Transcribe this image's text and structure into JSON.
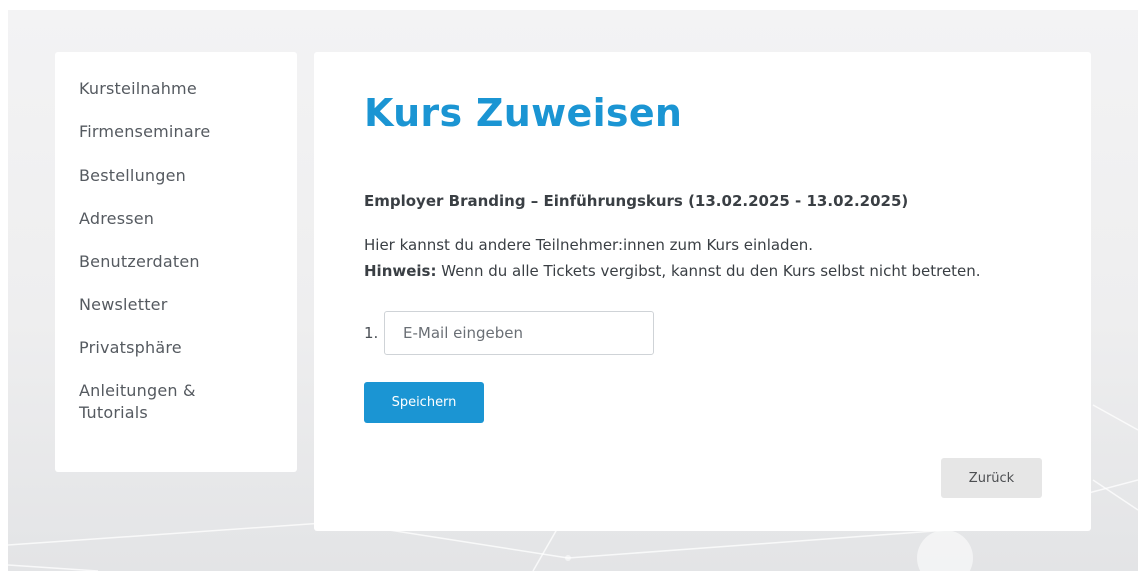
{
  "sidebar": {
    "items": [
      {
        "label": "Kursteilnahme"
      },
      {
        "label": "Firmenseminare"
      },
      {
        "label": "Bestellungen"
      },
      {
        "label": "Adressen"
      },
      {
        "label": "Benutzerdaten"
      },
      {
        "label": "Newsletter"
      },
      {
        "label": "Privatsphäre"
      },
      {
        "label": "Anleitungen & Tutorials"
      }
    ]
  },
  "main": {
    "title": "Kurs Zuweisen",
    "course_name": "Employer Branding – Einführungskurs (13.02.2025 - 13.02.2025)",
    "info_text": "Hier kannst du andere Teilnehmer:innen zum Kurs einladen.",
    "hint_label": "Hinweis:",
    "hint_text": " Wenn du alle Tickets vergibst, kannst du den Kurs selbst nicht betreten.",
    "email_rows": [
      {
        "number": "1.",
        "value": "",
        "placeholder": "E-Mail eingeben"
      }
    ],
    "save_label": "Speichern",
    "back_label": "Zurück"
  },
  "colors": {
    "accent": "#1b95d3",
    "text": "#3a3f44",
    "sidebar_text": "#555a60",
    "back_button_bg": "#e6e6e6",
    "page_background": "#eeeeef"
  }
}
